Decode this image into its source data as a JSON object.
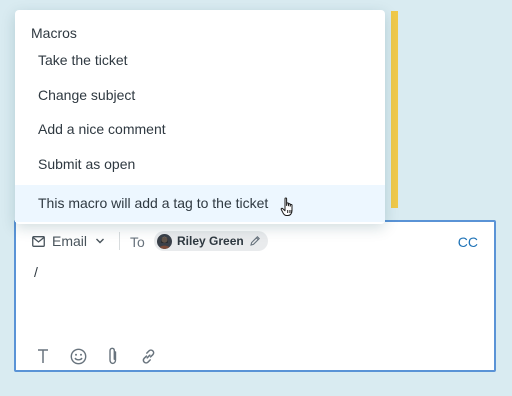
{
  "macros": {
    "title": "Macros",
    "items": [
      {
        "label": "Take the ticket"
      },
      {
        "label": "Change subject"
      },
      {
        "label": "Add a nice comment"
      },
      {
        "label": "Submit as open"
      },
      {
        "label": "This macro will add a tag to the ticket",
        "hovered": true
      }
    ]
  },
  "composer": {
    "channel": "Email",
    "to_label": "To",
    "recipient": "Riley Green",
    "cc_label": "CC",
    "text": "/",
    "tools": [
      "text-format-icon",
      "emoji-icon",
      "attachment-icon",
      "link-icon"
    ]
  },
  "colors": {
    "page_background": "#d9ebf1",
    "accent": "#1f73b7",
    "composer_border": "#5a93d6",
    "hover_background": "#edf7ff",
    "side_bar": "#f0c94a"
  }
}
